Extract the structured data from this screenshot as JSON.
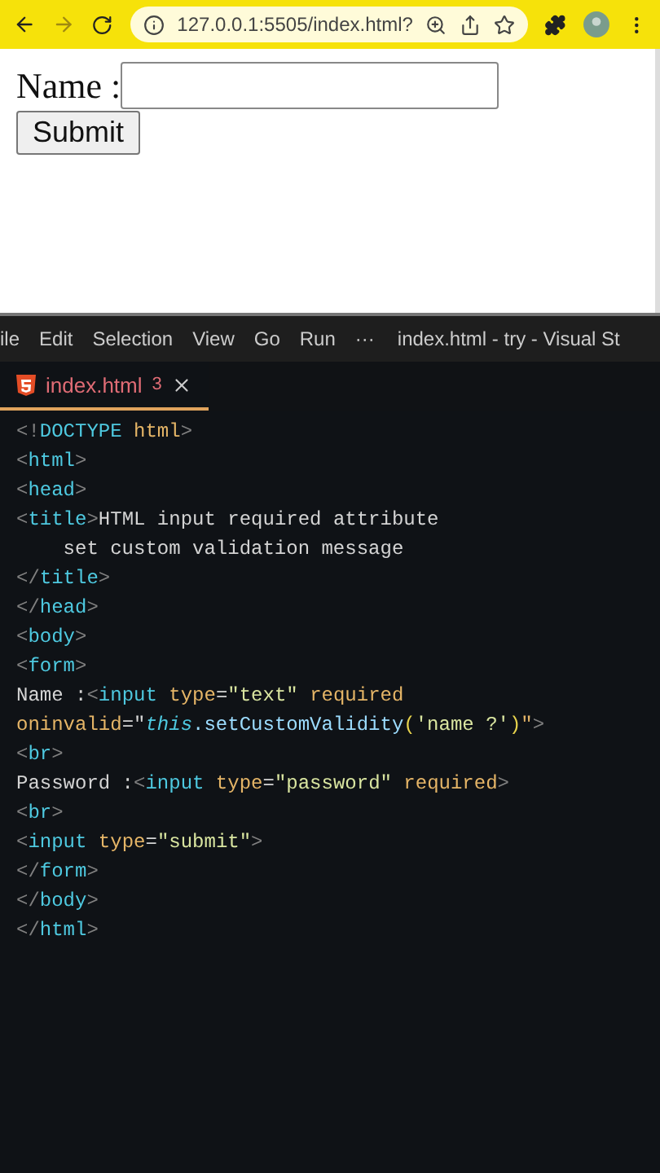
{
  "browser": {
    "url": "127.0.0.1:5505/index.html?"
  },
  "page": {
    "label": "Name :",
    "button": "Submit"
  },
  "menu_bar": {
    "items": [
      "ile",
      "Edit",
      "Selection",
      "View",
      "Go",
      "Run",
      "···"
    ],
    "title": "index.html - try - Visual St"
  },
  "tabs": [
    {
      "label": "index.html",
      "problems": "3",
      "selected": true
    }
  ],
  "code_lines": [
    {
      "tokens": [
        {
          "kind": "bracket",
          "text": "<!"
        },
        {
          "kind": "tag",
          "text": "DOCTYPE"
        },
        {
          "kind": "attr",
          "text": " html"
        },
        {
          "kind": "bracket",
          "text": ">"
        }
      ]
    },
    {
      "tokens": [
        {
          "kind": "bracket",
          "text": "<"
        },
        {
          "kind": "tag",
          "text": "html"
        },
        {
          "kind": "bracket",
          "text": ">"
        }
      ]
    },
    {
      "tokens": [
        {
          "kind": "bracket",
          "text": "<"
        },
        {
          "kind": "tag",
          "text": "head"
        },
        {
          "kind": "bracket",
          "text": ">"
        }
      ]
    },
    {
      "tokens": [
        {
          "kind": "bracket",
          "text": "<"
        },
        {
          "kind": "tag",
          "text": "title"
        },
        {
          "kind": "bracket",
          "text": ">"
        },
        {
          "kind": "plain",
          "text": "HTML input required attribute"
        }
      ]
    },
    {
      "tokens": [
        {
          "kind": "plain",
          "text": "    set custom validation message"
        }
      ]
    },
    {
      "tokens": [
        {
          "kind": "bracket",
          "text": "</"
        },
        {
          "kind": "tag",
          "text": "title"
        },
        {
          "kind": "bracket",
          "text": ">"
        }
      ]
    },
    {
      "tokens": [
        {
          "kind": "bracket",
          "text": "</"
        },
        {
          "kind": "tag",
          "text": "head"
        },
        {
          "kind": "bracket",
          "text": ">"
        }
      ]
    },
    {
      "tokens": [
        {
          "kind": "bracket",
          "text": "<"
        },
        {
          "kind": "tag",
          "text": "body"
        },
        {
          "kind": "bracket",
          "text": ">"
        }
      ]
    },
    {
      "tokens": [
        {
          "kind": "bracket",
          "text": "<"
        },
        {
          "kind": "tag",
          "text": "form"
        },
        {
          "kind": "bracket",
          "text": ">"
        }
      ]
    },
    {
      "tokens": [
        {
          "kind": "plain",
          "text": "Name :"
        },
        {
          "kind": "bracket",
          "text": "<"
        },
        {
          "kind": "tag",
          "text": "input"
        },
        {
          "kind": "attr",
          "text": " type"
        },
        {
          "kind": "plain",
          "text": "="
        },
        {
          "kind": "string",
          "text": "\"text\""
        },
        {
          "kind": "attr",
          "text": " required"
        }
      ]
    },
    {
      "tokens": [
        {
          "kind": "attr",
          "text": "oninvalid"
        },
        {
          "kind": "plain",
          "text": "=\""
        },
        {
          "kind": "keyword",
          "text": "this"
        },
        {
          "kind": "func",
          "text": ".setCustomValidity"
        },
        {
          "kind": "paren",
          "text": "("
        },
        {
          "kind": "string",
          "text": "'name ?'"
        },
        {
          "kind": "paren",
          "text": ")"
        },
        {
          "kind": "attr",
          "text": "\""
        },
        {
          "kind": "bracket",
          "text": ">"
        }
      ]
    },
    {
      "tokens": [
        {
          "kind": "bracket",
          "text": "<"
        },
        {
          "kind": "tag",
          "text": "br"
        },
        {
          "kind": "bracket",
          "text": ">"
        }
      ]
    },
    {
      "tokens": [
        {
          "kind": "plain",
          "text": "Password :"
        },
        {
          "kind": "bracket",
          "text": "<"
        },
        {
          "kind": "tag",
          "text": "input"
        },
        {
          "kind": "attr",
          "text": " type"
        },
        {
          "kind": "plain",
          "text": "="
        },
        {
          "kind": "string",
          "text": "\"password\""
        },
        {
          "kind": "attr",
          "text": " required"
        },
        {
          "kind": "bracket",
          "text": ">"
        }
      ]
    },
    {
      "tokens": [
        {
          "kind": "bracket",
          "text": "<"
        },
        {
          "kind": "tag",
          "text": "br"
        },
        {
          "kind": "bracket",
          "text": ">"
        }
      ]
    },
    {
      "tokens": [
        {
          "kind": "bracket",
          "text": "<"
        },
        {
          "kind": "tag",
          "text": "input"
        },
        {
          "kind": "attr",
          "text": " type"
        },
        {
          "kind": "plain",
          "text": "="
        },
        {
          "kind": "string",
          "text": "\"submit\""
        },
        {
          "kind": "bracket",
          "text": ">"
        }
      ]
    },
    {
      "tokens": [
        {
          "kind": "bracket",
          "text": "</"
        },
        {
          "kind": "tag",
          "text": "form"
        },
        {
          "kind": "bracket",
          "text": ">"
        }
      ]
    },
    {
      "tokens": [
        {
          "kind": "bracket",
          "text": "</"
        },
        {
          "kind": "tag",
          "text": "body"
        },
        {
          "kind": "bracket",
          "text": ">"
        }
      ]
    },
    {
      "tokens": [
        {
          "kind": "bracket",
          "text": "</"
        },
        {
          "kind": "tag",
          "text": "html"
        },
        {
          "kind": "bracket",
          "text": ">"
        }
      ]
    }
  ]
}
